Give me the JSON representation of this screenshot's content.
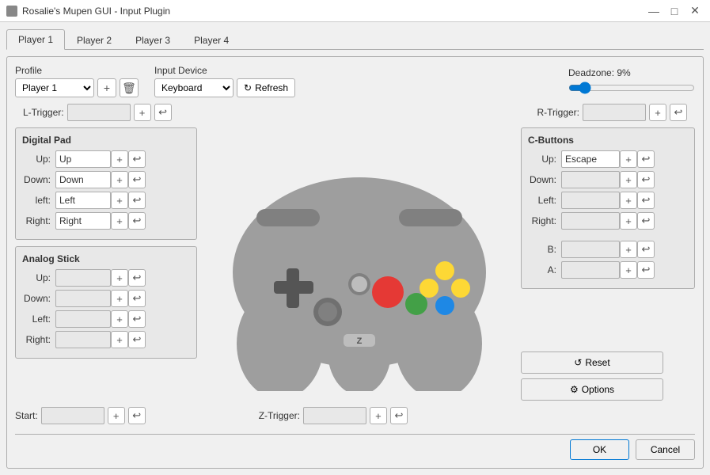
{
  "titlebar": {
    "title": "Rosalie's Mupen GUI - Input Plugin",
    "close_label": "✕",
    "minimize_label": "—",
    "maximize_label": "□"
  },
  "tabs": {
    "items": [
      {
        "label": "Player 1",
        "active": true
      },
      {
        "label": "Player 2",
        "active": false
      },
      {
        "label": "Player 3",
        "active": false
      },
      {
        "label": "Player 4",
        "active": false
      }
    ]
  },
  "profile": {
    "label": "Profile",
    "value": "Player 1",
    "add_label": "+",
    "delete_label": "🗑"
  },
  "input_device": {
    "label": "Input Device",
    "value": "Keyboard",
    "refresh_label": "Refresh"
  },
  "deadzone": {
    "label": "Deadzone: 9%",
    "value": 9
  },
  "triggers": {
    "l_trigger_label": "L-Trigger:",
    "l_trigger_value": "",
    "r_trigger_label": "R-Trigger:",
    "r_trigger_value": ""
  },
  "digital_pad": {
    "title": "Digital Pad",
    "up_label": "Up:",
    "up_value": "Up",
    "down_label": "Down:",
    "down_value": "Down",
    "left_label": "left:",
    "left_value": "Left",
    "right_label": "Right:",
    "right_value": "Right"
  },
  "analog_stick": {
    "title": "Analog Stick",
    "up_label": "Up:",
    "up_value": "",
    "down_label": "Down:",
    "down_value": "",
    "left_label": "Left:",
    "left_value": "",
    "right_label": "Right:",
    "right_value": ""
  },
  "c_buttons": {
    "title": "C-Buttons",
    "up_label": "Up:",
    "up_value": "Escape",
    "down_label": "Down:",
    "down_value": "",
    "left_label": "Left:",
    "left_value": "",
    "right_label": "Right:",
    "right_value": "",
    "b_label": "B:",
    "b_value": "",
    "a_label": "A:",
    "a_value": ""
  },
  "bottom_controls": {
    "start_label": "Start:",
    "start_value": "",
    "ztrigger_label": "Z-Trigger:",
    "ztrigger_value": ""
  },
  "action_buttons": {
    "reset_label": "Reset",
    "options_label": "Options"
  },
  "footer": {
    "ok_label": "OK",
    "cancel_label": "Cancel"
  },
  "icons": {
    "plus": "+",
    "delete": "🗑",
    "refresh": "↻",
    "reset": "↺",
    "options": "⚙",
    "clear": "↩"
  }
}
